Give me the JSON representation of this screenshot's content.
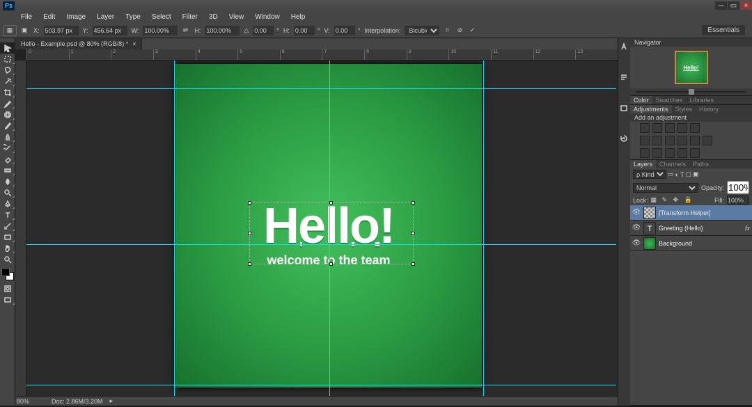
{
  "menu": {
    "items": [
      "File",
      "Edit",
      "Image",
      "Layer",
      "Type",
      "Select",
      "Filter",
      "3D",
      "View",
      "Window",
      "Help"
    ]
  },
  "optbar": {
    "x_lbl": "X:",
    "x": "503.97 px",
    "y_lbl": "Y:",
    "y": "456.64 px",
    "w_lbl": "W:",
    "w": "100.00%",
    "h_lbl": "H:",
    "h": "100.00%",
    "r_lbl": "△",
    "r": "0.00",
    "sh_lbl": "H:",
    "sh": "0.00",
    "sv_lbl": "V:",
    "sv": "0.00",
    "interp_lbl": "Interpolation:",
    "interp": "Bicubic",
    "workspace": "Essentials"
  },
  "tab": {
    "title": "Hello - Example.psd @ 80% (RGB/8) *",
    "close": "×"
  },
  "ruler": {
    "marks": [
      "0",
      "1",
      "2",
      "3",
      "4",
      "5",
      "6",
      "7",
      "8",
      "9",
      "10",
      "11",
      "12",
      "13"
    ]
  },
  "canvas": {
    "hello": "Hello!",
    "subtitle": "welcome to the team"
  },
  "status": {
    "zoom": "80%",
    "doc": "Doc: 2.86M/3.20M"
  },
  "navigator": {
    "title": "Navigator"
  },
  "color": {
    "tabs": [
      "Color",
      "Swatches",
      "Libraries"
    ]
  },
  "adjust": {
    "tabs": [
      "Adjustments",
      "Styles",
      "History"
    ],
    "add": "Add an adjustment"
  },
  "layers": {
    "tabs": [
      "Layers",
      "Channels",
      "Paths"
    ],
    "kind": "ρ Kind",
    "normal": "Normal",
    "opacity_lbl": "Opacity:",
    "opacity": "100%",
    "lock_lbl": "Lock:",
    "fill_lbl": "Fill:",
    "fill": "100%",
    "items": [
      {
        "name": "[Transform Helper]",
        "type": "pixel",
        "sel": true,
        "fx": ""
      },
      {
        "name": "Greeting (Hello)",
        "type": "text",
        "sel": false,
        "fx": "fx"
      },
      {
        "name": "Background",
        "type": "bg",
        "sel": false,
        "fx": ""
      }
    ]
  }
}
